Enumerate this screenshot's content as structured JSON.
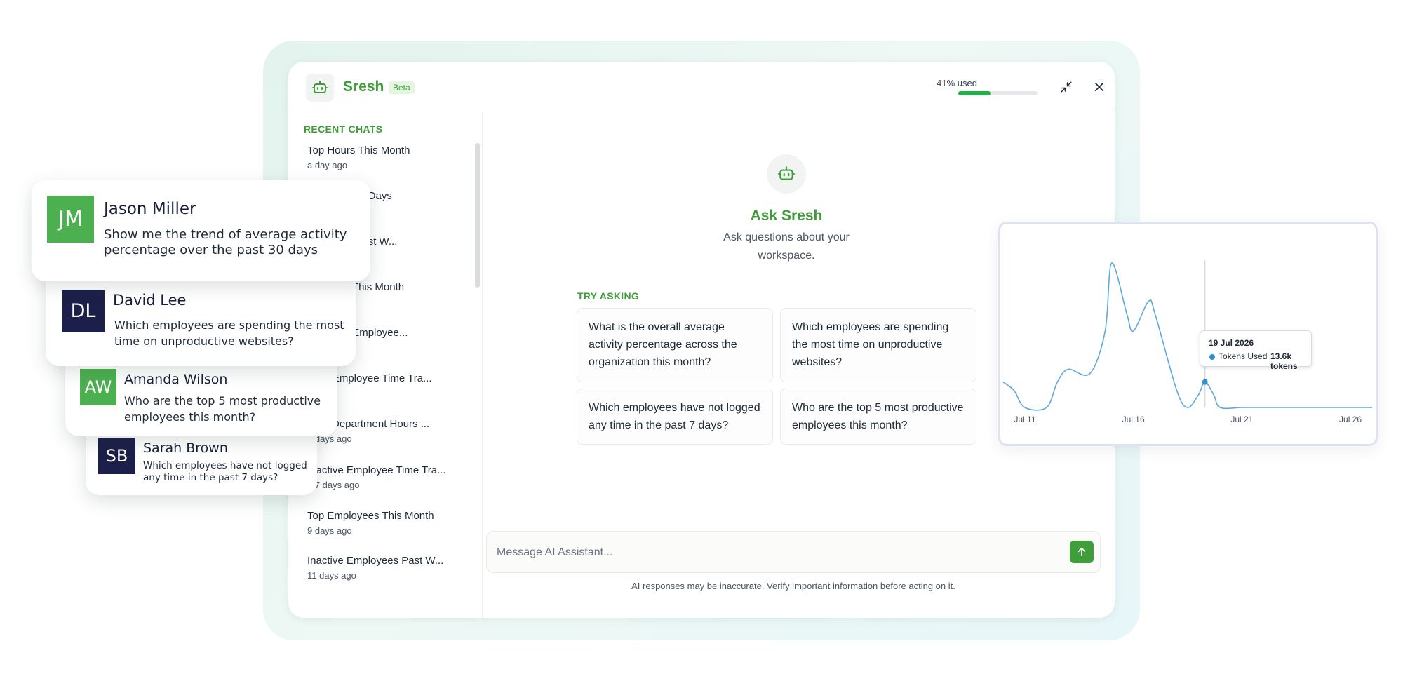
{
  "app": {
    "brand": "Sresh",
    "badge": "Beta",
    "usage_label": "41% used",
    "usage_fraction": 0.41,
    "accent_color": "#3f9e3a",
    "usage_color": "#22b04b"
  },
  "header_icons": {
    "minimize": "collapse-icon",
    "close": "close-icon"
  },
  "sidebar": {
    "title": "RECENT CHATS",
    "items": [
      {
        "title": "Top Hours This Month",
        "date": "a day ago"
      },
      {
        "title": "...ed Last 30 Days",
        "date": ""
      },
      {
        "title": "...ployees Past W...",
        "date": ""
      },
      {
        "title": "...Activity This Month",
        "date": ""
      },
      {
        "title": "...ductive Employee...",
        "date": ""
      },
      {
        "title": "...ive Employee Time Tra...",
        "date": "...ago"
      },
      {
        "title": "...kly Department Hours ...",
        "date": "...days ago"
      },
      {
        "title": "...active Employee Time Tra...",
        "date": "...7 days ago"
      },
      {
        "title": "Top Employees This Month",
        "date": "9 days ago"
      },
      {
        "title": "Inactive Employees Past W...",
        "date": "11 days ago"
      }
    ]
  },
  "main": {
    "ask_title": "Ask Sresh",
    "ask_subtitle": "Ask questions about your workspace.",
    "try_title": "TRY ASKING",
    "suggestions": [
      "What is the overall average activity percentage across the organization this month?",
      "Which employees are spending the most time on unproductive websites?",
      "Which employees have not logged any time in the past 7 days?",
      "Who are the top 5 most productive employees this month?"
    ],
    "composer_placeholder": "Message AI Assistant...",
    "disclaimer": "AI responses may be inaccurate. Verify important information before acting on it."
  },
  "cards": [
    {
      "initials": "JM",
      "name": "Jason Miller",
      "question": "Show me the trend of average activity percentage over the past 30 days",
      "color": "#4caf50"
    },
    {
      "initials": "DL",
      "name": "David Lee",
      "question": "Which employees are spending the most time on unproductive websites?",
      "color": "#1c1f4a"
    },
    {
      "initials": "AW",
      "name": "Amanda Wilson",
      "question": "Who are the top 5 most productive employees this month?",
      "color": "#4caf50"
    },
    {
      "initials": "SB",
      "name": "Sarah Brown",
      "question": "Which employees have not logged any time in the past 7 days?",
      "color": "#1c1f4a"
    }
  ],
  "chart_data": {
    "type": "line",
    "title": "",
    "xlabel": "",
    "ylabel": "",
    "x_ticks": [
      "Jul 11",
      "Jul 16",
      "Jul 21",
      "Jul 26"
    ],
    "series": [
      {
        "name": "Tokens Used",
        "color": "#5fa8dc",
        "points": [
          [
            10,
            3
          ],
          [
            10.5,
            2
          ],
          [
            11,
            0
          ],
          [
            12,
            0
          ],
          [
            12.5,
            3
          ],
          [
            13,
            4.5
          ],
          [
            14,
            4
          ],
          [
            14.7,
            9
          ],
          [
            15,
            17
          ],
          [
            15.7,
            11
          ],
          [
            16,
            9
          ],
          [
            16.7,
            12.5
          ],
          [
            17,
            11
          ],
          [
            18,
            2
          ],
          [
            18.5,
            0
          ],
          [
            19,
            1.5
          ],
          [
            19.3,
            3
          ],
          [
            19.7,
            1.5
          ],
          [
            20,
            0
          ],
          [
            21,
            0
          ],
          [
            22,
            0
          ],
          [
            23,
            0
          ],
          [
            24,
            0
          ],
          [
            25,
            0
          ],
          [
            26,
            0
          ],
          [
            27,
            0
          ]
        ]
      }
    ],
    "tooltip": {
      "date": "19 Jul 2026",
      "series": "Tokens Used",
      "value": "13.6k tokens"
    },
    "grid": false,
    "legend": "none"
  }
}
